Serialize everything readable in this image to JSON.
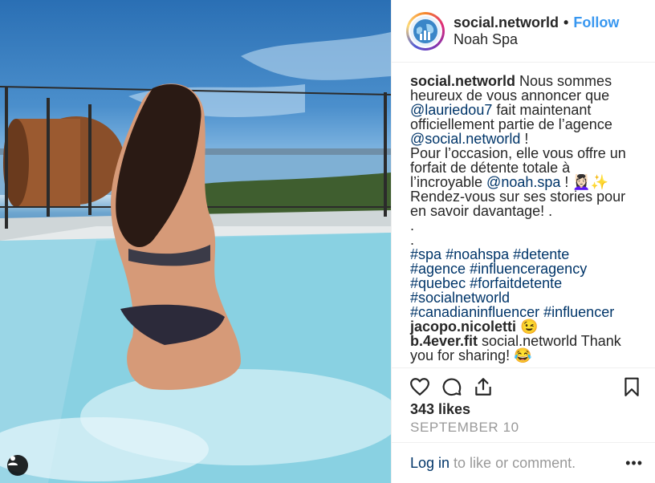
{
  "photo": {
    "alt": ""
  },
  "header": {
    "username": "social.networld",
    "separator": "•",
    "follow_label": "Follow",
    "location": "Noah Spa"
  },
  "caption": {
    "username": "social.networld",
    "part1": " Nous sommes heureux de vous annoncer que ",
    "mention1": "@lauriedou7",
    "part2": " fait maintenant officiellement partie de l’agence ",
    "mention2": "@social.networld",
    "part3": " !",
    "line2": "Pour l’occasion, elle vous offre un forfait de détente totale à l’incroyable ",
    "mention3": "@noah.spa",
    "part4": " ! 💆🏻‍♀️✨",
    "line3": "Rendez-vous sur ses stories pour en savoir davantage! .",
    "dot1": ".",
    "dot2": ".",
    "hashtags": [
      "#spa",
      "#noahspa",
      "#detente",
      "#agence",
      "#influenceragency",
      "#quebec",
      "#forfaitdetente",
      "#socialnetworld",
      "#canadianinfluencer",
      "#influencer"
    ]
  },
  "comments": [
    {
      "username": "jacopo.nicoletti",
      "text": " 😉"
    },
    {
      "username": "b.4ever.fit",
      "text": " social.networld Thank you for sharing! 😂"
    }
  ],
  "likes": "343 likes",
  "date": "SEPTEMBER 10",
  "login": {
    "link": "Log in",
    "rest": " to like or comment."
  },
  "more_label": "•••",
  "icons": [
    "heart-icon",
    "comment-icon",
    "share-icon",
    "bookmark-icon",
    "user-tag-icon"
  ]
}
